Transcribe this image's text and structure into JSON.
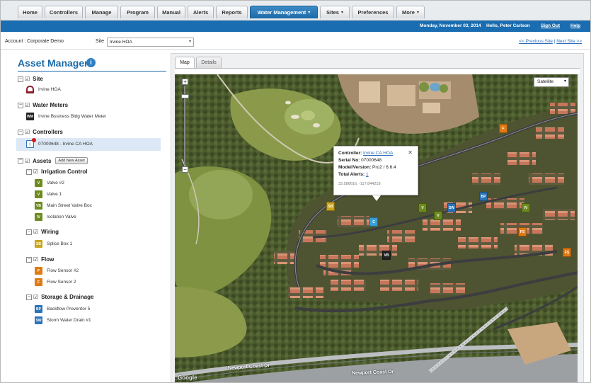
{
  "nav": {
    "tabs": [
      {
        "label": "Home"
      },
      {
        "label": "Controllers"
      },
      {
        "label": "Manage"
      },
      {
        "label": "Program"
      },
      {
        "label": "Manual"
      },
      {
        "label": "Alerts"
      },
      {
        "label": "Reports"
      },
      {
        "label": "Water Management"
      },
      {
        "label": "Sites"
      },
      {
        "label": "Preferences"
      },
      {
        "label": "More"
      }
    ],
    "active": "Water Management"
  },
  "topbar": {
    "date": "Monday, November 03, 2014",
    "greeting": "Hello, Peter Carlson",
    "sign_out": "Sign Out",
    "help": "Help"
  },
  "account": {
    "label": "Account : Corporate Demo",
    "site_label": "Site",
    "site_value": "Irvine HOA",
    "prev_site": "<< Previous Site",
    "separator": "|",
    "next_site": "Next Site >>"
  },
  "asset_manager": {
    "title": "Asset Manager",
    "site": {
      "header": "Site",
      "items": [
        "Irvine HOA"
      ]
    },
    "water_meters": {
      "header": "Water Meters",
      "items": [
        "Irvine Business Bldg Water Meter"
      ]
    },
    "controllers": {
      "header": "Controllers",
      "items": [
        "07000648 - Irvine CA HOA"
      ]
    },
    "assets": {
      "header": "Assets",
      "add_button": "Add New Asset",
      "irrigation": {
        "header": "Irrigation Control",
        "items": [
          {
            "code": "V",
            "label": "Valve #2"
          },
          {
            "code": "V",
            "label": "Valve 1"
          },
          {
            "code": "VB",
            "label": "Main Street Valve Box"
          },
          {
            "code": "IV",
            "label": "Isolation Valve"
          }
        ]
      },
      "wiring": {
        "header": "Wiring",
        "items": [
          {
            "code": "SB",
            "label": "Splice Box 1"
          }
        ]
      },
      "flow": {
        "header": "Flow",
        "items": [
          {
            "code": "F",
            "label": "Flow Sensor #2"
          },
          {
            "code": "F",
            "label": "Flow Sensor 2"
          }
        ]
      },
      "storage": {
        "header": "Storage & Drainage",
        "items": [
          {
            "code": "BP",
            "label": "Backflow Preventor 5"
          },
          {
            "code": "SW",
            "label": "Storm Water Drain #1"
          }
        ]
      }
    }
  },
  "map": {
    "tabs": [
      "Map",
      "Details"
    ],
    "active_tab": "Map",
    "map_type": "Satellite",
    "zoom_in": "+",
    "zoom_out": "−",
    "popup": {
      "controller_label": "Controller:",
      "controller_value": "Irvine CA HOA",
      "serial_label": "Serial No:",
      "serial_value": "07000648",
      "model_label": "Model/Version:",
      "model_value": "Pro2 / 6.6.4",
      "alerts_label": "Total Alerts:",
      "alerts_value": "1",
      "coords": "33.586616, -117.844218",
      "close": "✕"
    },
    "markers": [
      {
        "code": "SB",
        "color": "yellow"
      },
      {
        "code": "V",
        "color": "green"
      },
      {
        "code": "V",
        "color": "green"
      },
      {
        "code": "SW",
        "color": "blue"
      },
      {
        "code": "BP",
        "color": "blue"
      },
      {
        "code": "IV",
        "color": "green"
      },
      {
        "code": "F",
        "color": "orange"
      },
      {
        "code": "FS",
        "color": "orange"
      },
      {
        "code": "FS",
        "color": "orange"
      },
      {
        "code": "VB",
        "color": "black"
      },
      {
        "code": "C",
        "color": "lblue"
      }
    ],
    "roads": [
      "Newport Coast Dr",
      "Newport Coast Dr"
    ],
    "attribution": "Google"
  }
}
